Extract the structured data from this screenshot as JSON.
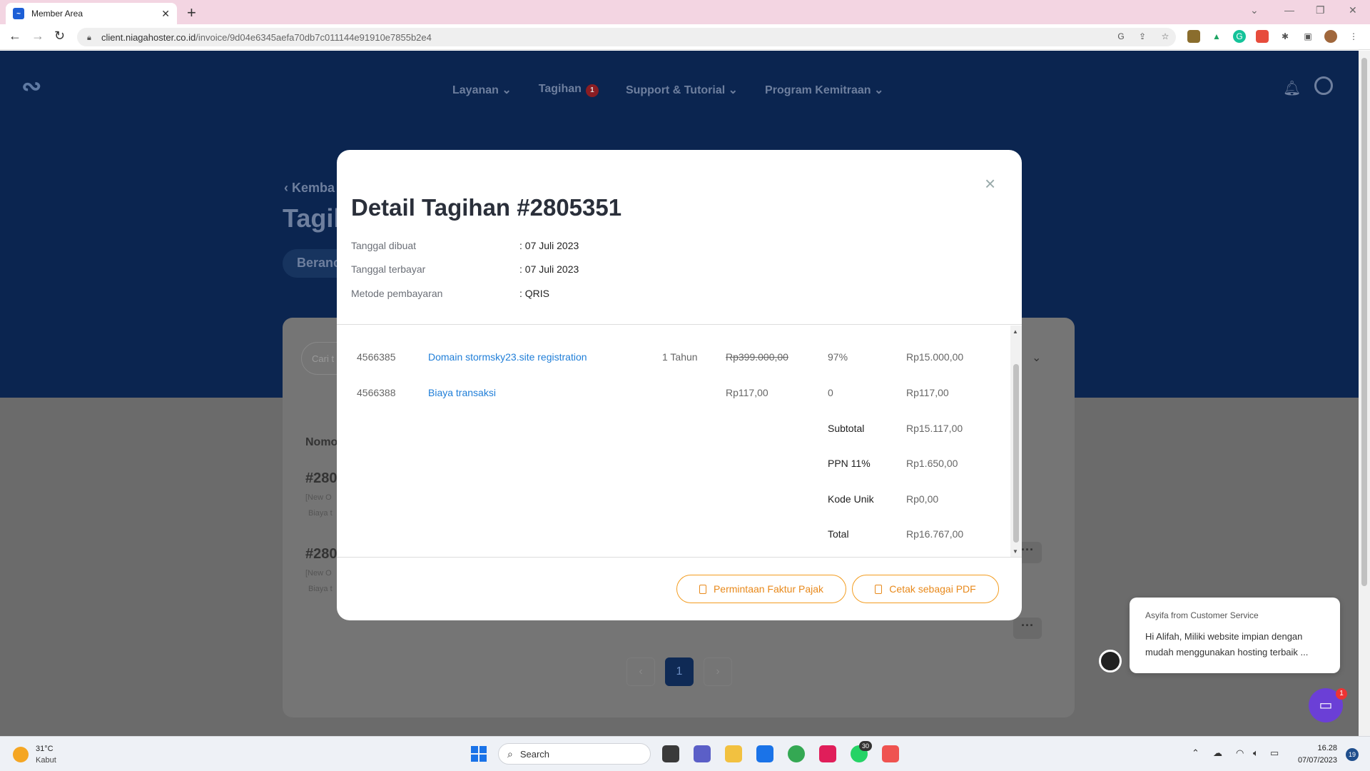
{
  "browser": {
    "tab_title": "Member Area",
    "url_host": "client.niagahoster.co.id",
    "url_path": "/invoice/9d04e6345aefa70db7c011144e91910e7855b2e4"
  },
  "site": {
    "nav": [
      {
        "label": "Layanan"
      },
      {
        "label": "Tagihan",
        "badge": "1"
      },
      {
        "label": "Support & Tutorial"
      },
      {
        "label": "Program Kemitraan"
      }
    ],
    "back_label": "Kemba",
    "page_heading": "Tagih",
    "crumb": "Beranc",
    "search_placeholder": "Cari t",
    "col_head": "Nomo",
    "rows": [
      {
        "id": "#280",
        "sub1": "[New O",
        "sub2": "Biaya t"
      },
      {
        "id": "#280",
        "sub1": "[New O",
        "sub2": "Biaya t"
      }
    ],
    "page_number": "1"
  },
  "modal": {
    "title": "Detail Tagihan #2805351",
    "meta": [
      {
        "label": "Tanggal dibuat",
        "value": ": 07 Juli 2023"
      },
      {
        "label": "Tanggal terbayar",
        "value": ": 07 Juli 2023"
      },
      {
        "label": "Metode pembayaran",
        "value": ": QRIS"
      }
    ],
    "items": [
      {
        "id": "4566385",
        "desc": "Domain stormsky23.site registration",
        "period": "1 Tahun",
        "price": "Rp399.000,00",
        "discount": "97%",
        "amount": "Rp15.000,00"
      },
      {
        "id": "4566388",
        "desc": "Biaya transaksi",
        "period": "",
        "price": "Rp117,00",
        "discount": "0",
        "amount": "Rp117,00"
      }
    ],
    "summary": [
      {
        "label": "Subtotal",
        "value": "Rp15.117,00"
      },
      {
        "label": "PPN 11%",
        "value": "Rp1.650,00"
      },
      {
        "label": "Kode Unik",
        "value": "Rp0,00"
      },
      {
        "label": "Total",
        "value": "Rp16.767,00"
      }
    ],
    "btn_tax": "Permintaan Faktur Pajak",
    "btn_pdf": "Cetak sebagai PDF"
  },
  "chat": {
    "from": "Asyifa from Customer Service",
    "message": "Hi Alifah, Miliki website impian dengan mudah menggunakan hosting terbaik ...",
    "unread": "1"
  },
  "taskbar": {
    "temp": "31°C",
    "weather": "Kabut",
    "search_label": "Search",
    "whatsapp_badge": "30",
    "time": "16.28",
    "date": "07/07/2023",
    "notifications": "19"
  },
  "colors": {
    "hero": "#0b2550",
    "accent_orange": "#f39c1f",
    "link_blue": "#1f7ed8",
    "chat_purple": "#6b3fd6"
  }
}
